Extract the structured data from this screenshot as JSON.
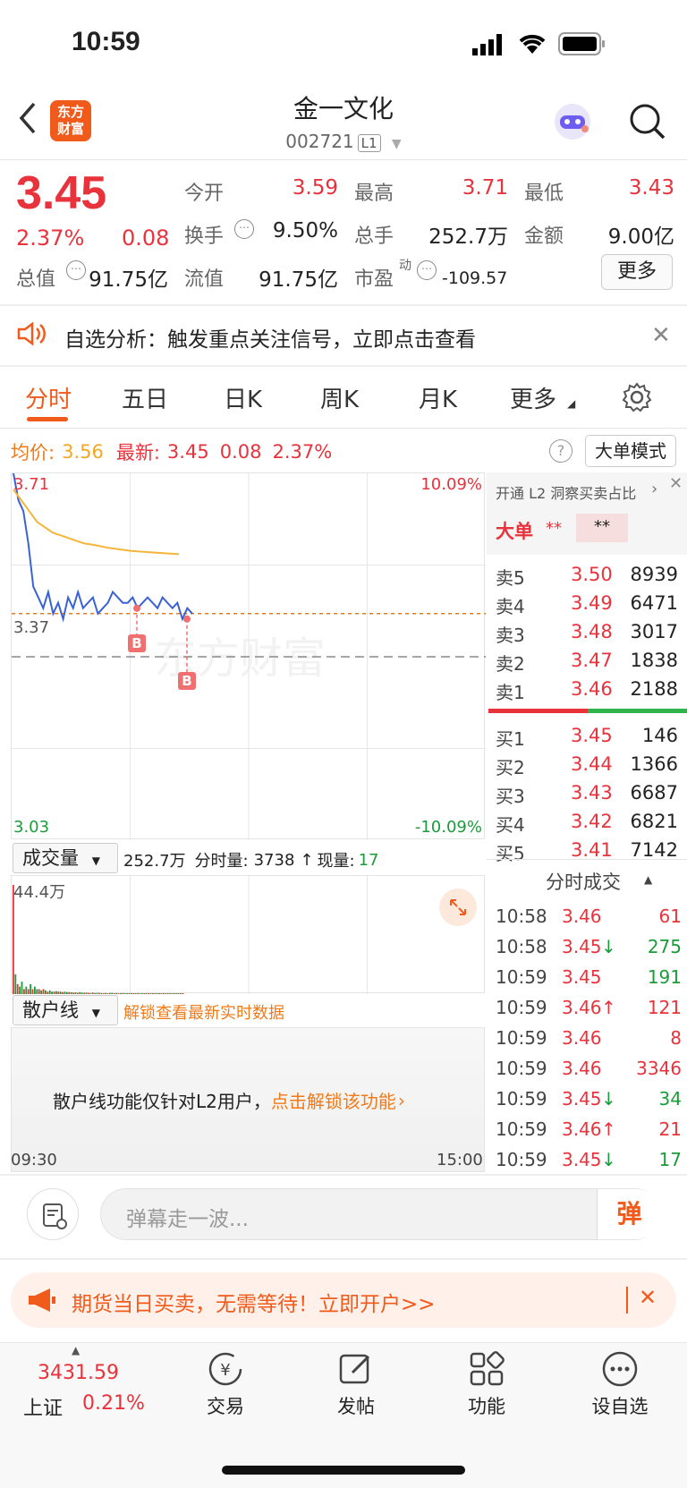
{
  "status": {
    "time": "10:59"
  },
  "header": {
    "logo": [
      "东方",
      "财富"
    ],
    "title": "金一文化",
    "code": "002721",
    "level": "L1"
  },
  "quote": {
    "price": "3.45",
    "change_pct": "2.37%",
    "change": "0.08",
    "fields": [
      {
        "label": "今开",
        "value": "3.59",
        "color": "red"
      },
      {
        "label": "最高",
        "value": "3.71",
        "color": "red"
      },
      {
        "label": "最低",
        "value": "3.43",
        "color": "red"
      },
      {
        "label": "换手",
        "value": "9.50%",
        "color": "dark"
      },
      {
        "label": "总手",
        "value": "252.7万",
        "color": "dark"
      },
      {
        "label": "金额",
        "value": "9.00亿",
        "color": "dark"
      },
      {
        "label": "总值",
        "value": "91.75亿",
        "color": "dark"
      },
      {
        "label": "流值",
        "value": "91.75亿",
        "color": "dark"
      },
      {
        "label": "市盈",
        "value": "-109.57",
        "color": "dark"
      }
    ],
    "pe_superscript": "动",
    "more_button": "更多"
  },
  "notice": {
    "label": "自选分析：",
    "text": "触发重点关注信号，立即点击查看"
  },
  "tabs": [
    "分时",
    "五日",
    "日K",
    "周K",
    "月K",
    "更多"
  ],
  "active_tab": 0,
  "chart_header": {
    "avg_label": "均价:",
    "avg_value": "3.56",
    "latest_label": "最新:",
    "latest_price": "3.45",
    "latest_change": "0.08",
    "latest_pct": "2.37%",
    "mode_button": "大单模式"
  },
  "chart_data": {
    "type": "line",
    "title": "",
    "y_max": "3.71",
    "y_min": "3.03",
    "y_ref": "3.37",
    "pct_max": "10.09%",
    "pct_min": "-10.09%",
    "x_start": "09:30",
    "x_end": "15:00",
    "ylim": [
      3.03,
      3.71
    ],
    "series": [
      {
        "values": [
          3.71,
          3.66,
          3.64,
          3.58,
          3.5,
          3.48,
          3.46,
          3.49,
          3.45,
          3.47,
          3.44,
          3.48,
          3.46,
          3.49,
          3.46,
          3.47,
          3.48,
          3.45,
          3.46,
          3.47,
          3.49,
          3.48,
          3.47,
          3.47,
          3.48,
          3.46,
          3.47,
          3.48,
          3.47,
          3.46,
          3.48,
          3.47,
          3.46,
          3.47,
          3.44,
          3.46,
          3.45
        ]
      },
      {
        "values": [
          3.68,
          3.66,
          3.64,
          3.62,
          3.61,
          3.6,
          3.595,
          3.59,
          3.585,
          3.58,
          3.578,
          3.575,
          3.572,
          3.57,
          3.568,
          3.566,
          3.565,
          3.564,
          3.563,
          3.562,
          3.561,
          3.56
        ]
      }
    ],
    "markers": [
      "B",
      "B"
    ],
    "volume_label": "成交量",
    "volume_total": "252.7万",
    "volume_detail_label": "分时量:",
    "volume_detail": "3738",
    "volume_now_label": "现量:",
    "volume_now": "17",
    "volume_max": "44.4万",
    "volume_bars": [
      44,
      8,
      4,
      3,
      5,
      2,
      3,
      2,
      4,
      2,
      3,
      2,
      2,
      1.5,
      2,
      1.5,
      1,
      1.5,
      1,
      1,
      1.2,
      1,
      1,
      0.8,
      1,
      0.8,
      0.8,
      0.7,
      0.6,
      0.7,
      0.5,
      0.8,
      0.6,
      0.5,
      0.6,
      0.5,
      0.4,
      0.6,
      0.4,
      0.5,
      0.5,
      0.4,
      0.3,
      0.4,
      0.3,
      0.4,
      0.5,
      0.3,
      0.4,
      0.3,
      0.3,
      0.4,
      0.3,
      0.3,
      0.2,
      0.3,
      0.3,
      0.2,
      0.3,
      0.2,
      0.3,
      0.2,
      0.3,
      0.2,
      0.2,
      0.3,
      0.2,
      0.2,
      0.2,
      0.3,
      0.2,
      0.2,
      0.3,
      0.2,
      0.2,
      0.2,
      0.3,
      0.2,
      0.2,
      0.2
    ],
    "volume_colors_pattern": [
      "red",
      "green",
      "red",
      "green",
      "green",
      "red",
      "green"
    ]
  },
  "retail": {
    "label": "散户线",
    "unlock": "解锁查看最新实时数据",
    "message": "散户线功能仅针对L2用户，",
    "cta": "点击解锁该功能"
  },
  "orderbook": {
    "l2_banner": "开通 L2 洞察买卖占比",
    "big_order": "大单",
    "big_mask": "**",
    "sells": [
      {
        "label": "卖5",
        "price": "3.50",
        "vol": "8939"
      },
      {
        "label": "卖4",
        "price": "3.49",
        "vol": "6471"
      },
      {
        "label": "卖3",
        "price": "3.48",
        "vol": "3017"
      },
      {
        "label": "卖2",
        "price": "3.47",
        "vol": "1838"
      },
      {
        "label": "卖1",
        "price": "3.46",
        "vol": "2188"
      }
    ],
    "buys": [
      {
        "label": "买1",
        "price": "3.45",
        "vol": "146"
      },
      {
        "label": "买2",
        "price": "3.44",
        "vol": "1366"
      },
      {
        "label": "买3",
        "price": "3.43",
        "vol": "6687"
      },
      {
        "label": "买4",
        "price": "3.42",
        "vol": "6821"
      },
      {
        "label": "买5",
        "price": "3.41",
        "vol": "7142"
      }
    ],
    "sell_ratio": 0.5
  },
  "ticks": {
    "title": "分时成交",
    "rows": [
      {
        "time": "10:58",
        "price": "3.46",
        "arrow": "",
        "vol": "61",
        "vol_color": "red"
      },
      {
        "time": "10:58",
        "price": "3.45",
        "arrow": "↓",
        "vol": "275",
        "vol_color": "green"
      },
      {
        "time": "10:59",
        "price": "3.45",
        "arrow": "",
        "vol": "191",
        "vol_color": "green"
      },
      {
        "time": "10:59",
        "price": "3.46",
        "arrow": "↑",
        "vol": "121",
        "vol_color": "red"
      },
      {
        "time": "10:59",
        "price": "3.46",
        "arrow": "",
        "vol": "8",
        "vol_color": "red"
      },
      {
        "time": "10:59",
        "price": "3.46",
        "arrow": "",
        "vol": "3346",
        "vol_color": "red"
      },
      {
        "time": "10:59",
        "price": "3.45",
        "arrow": "↓",
        "vol": "34",
        "vol_color": "green"
      },
      {
        "time": "10:59",
        "price": "3.46",
        "arrow": "↑",
        "vol": "21",
        "vol_color": "red"
      },
      {
        "time": "10:59",
        "price": "3.45",
        "arrow": "↓",
        "vol": "17",
        "vol_color": "green"
      }
    ]
  },
  "comment": {
    "placeholder": "弹幕走一波...",
    "send": "弹"
  },
  "ad": {
    "text": "期货当日买卖，无需等待！立即开户>>"
  },
  "bottom_nav": {
    "index_value": "3431.59",
    "index_name": "上证",
    "index_pct": "0.21%",
    "items": [
      "交易",
      "发帖",
      "功能",
      "设自选"
    ]
  },
  "colors": {
    "red": "#e8323c",
    "green": "#1a9c3a",
    "orange": "#f07a1a",
    "avg": "#f5b53a"
  }
}
